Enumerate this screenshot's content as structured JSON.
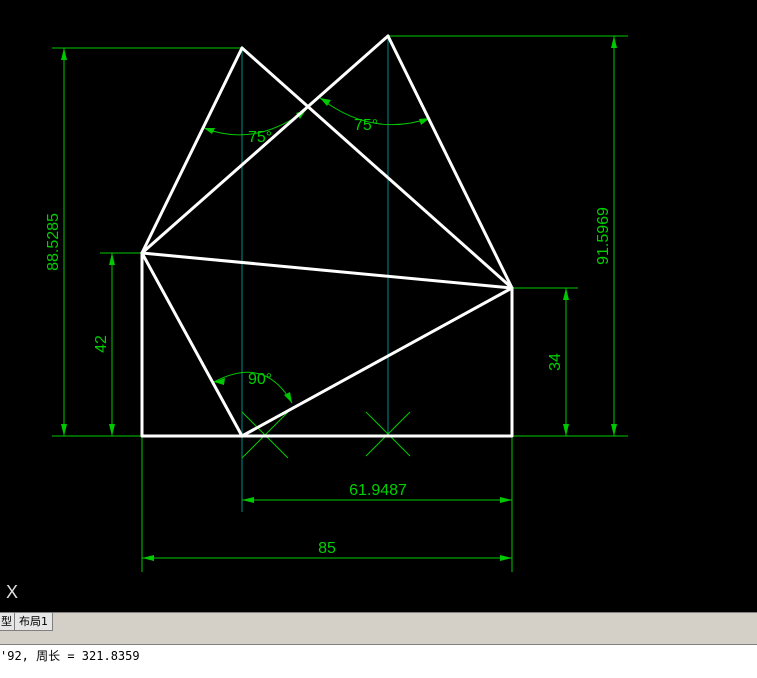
{
  "drawing": {
    "dimensions": {
      "height_left": "88.5285",
      "height_right": "91.5969",
      "side_left": "42",
      "side_right": "34",
      "partial_width": "61.9487",
      "total_width": "85"
    },
    "angles": {
      "left_apex": "75°",
      "right_apex": "75°",
      "bottom": "90°"
    },
    "ucs_icon": "X"
  },
  "tabs": [
    {
      "label": "型"
    },
    {
      "label": "布局1"
    }
  ],
  "command_line": {
    "text": "'92, 周长 = 321.8359"
  }
}
